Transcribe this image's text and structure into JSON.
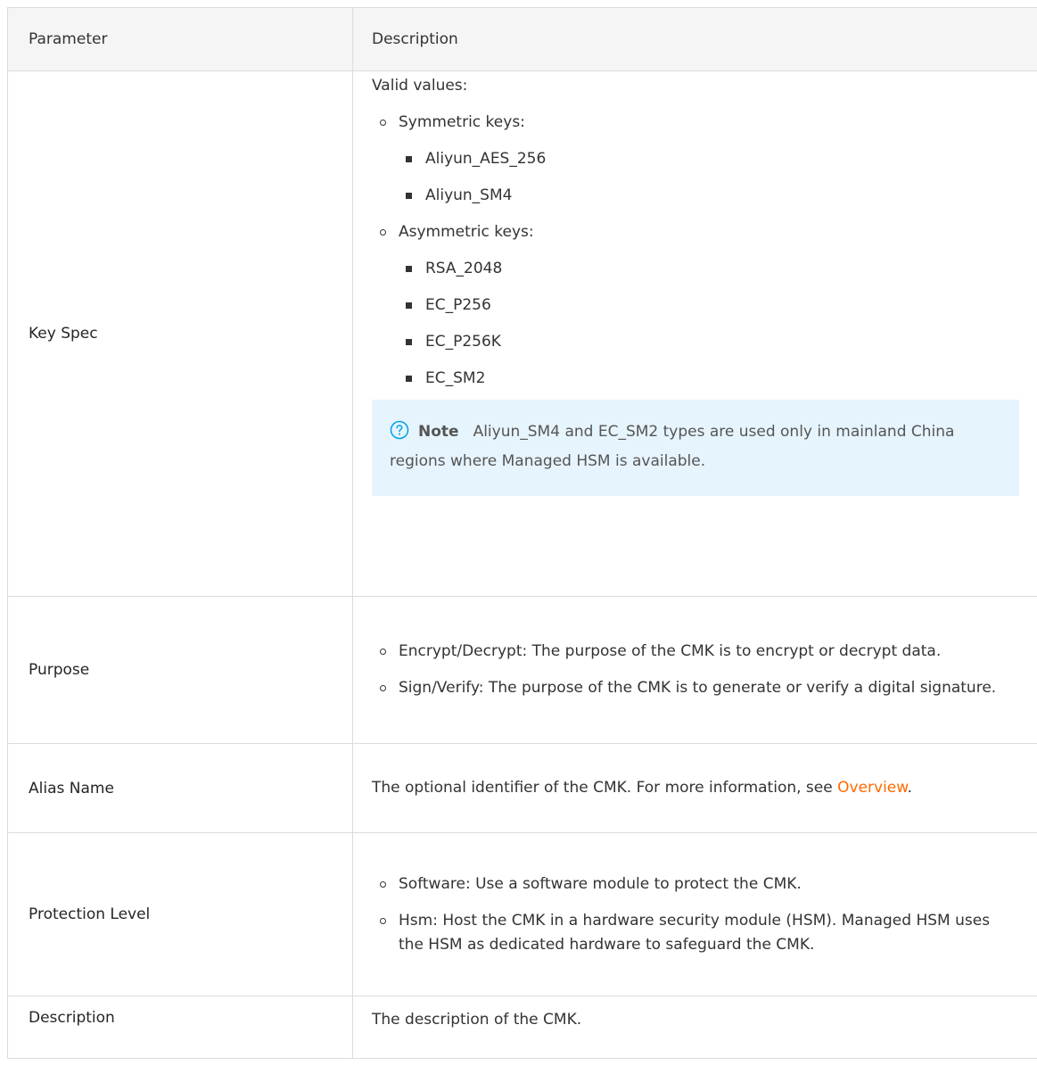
{
  "table": {
    "headers": {
      "parameter": "Parameter",
      "description": "Description"
    }
  },
  "rows": {
    "key_spec": {
      "name": "Key Spec",
      "intro": "Valid values:",
      "symmetric_label": "Symmetric keys:",
      "symmetric_items": [
        "Aliyun_AES_256",
        "Aliyun_SM4"
      ],
      "asymmetric_label": "Asymmetric keys:",
      "asymmetric_items": [
        "RSA_2048",
        "EC_P256",
        "EC_P256K",
        "EC_SM2"
      ],
      "note": {
        "label": "Note",
        "text": "Aliyun_SM4 and EC_SM2 types are used only in mainland China regions where Managed HSM is available.",
        "icon": "question-circle-icon",
        "icon_color": "#00a0e9"
      }
    },
    "purpose": {
      "name": "Purpose",
      "items": [
        "Encrypt/Decrypt: The purpose of the CMK is to encrypt or decrypt data.",
        "Sign/Verify: The purpose of the CMK is to generate or verify a digital signature."
      ]
    },
    "alias_name": {
      "name": "Alias Name",
      "text": "The optional identifier of the CMK. For more information, see",
      "link_text": "Overview",
      "link_color": "#ff6a00",
      "suffix": "."
    },
    "protection_level": {
      "name": "Protection Level",
      "items": [
        "Software: Use a software module to protect the CMK.",
        "Hsm: Host the CMK in a hardware security module (HSM). Managed HSM uses the HSM as dedicated hardware to safeguard the CMK."
      ]
    },
    "description": {
      "name": "Description",
      "text": "The description of the CMK."
    }
  }
}
